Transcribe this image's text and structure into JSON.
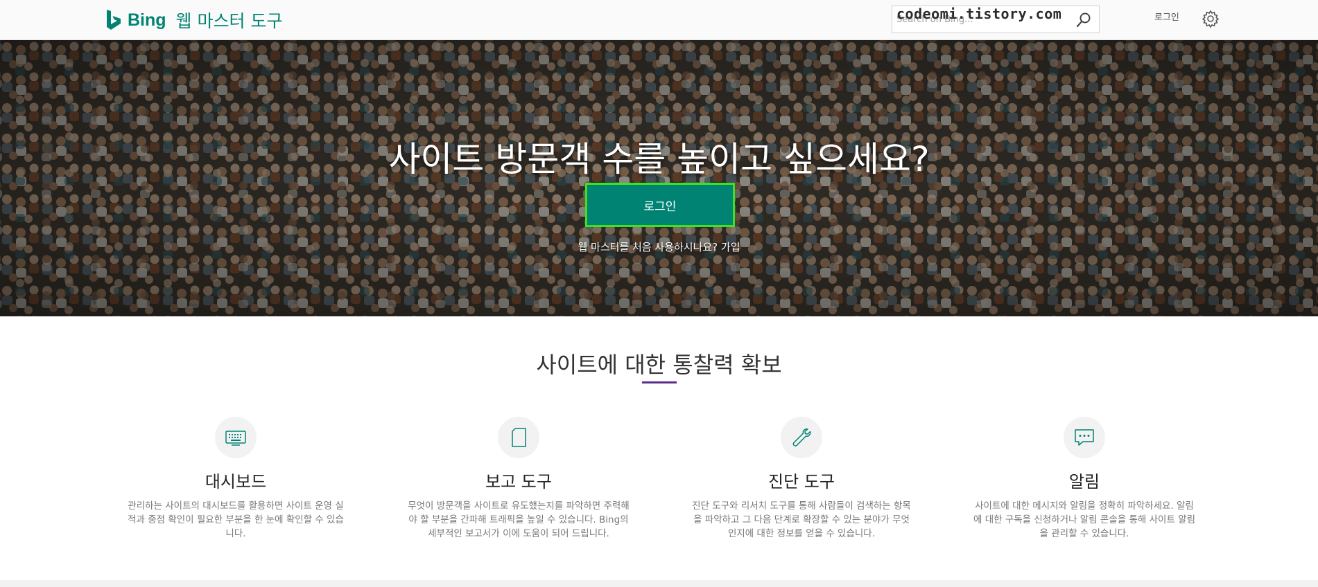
{
  "header": {
    "brand": "Bing",
    "product_title": "웹 마스터 도구",
    "search_placeholder": "Search on Bing...",
    "login_label": "로그인",
    "watermark": "codeomi.tistory.com"
  },
  "hero": {
    "headline": "사이트 방문객 수를 높이고 싶으세요?",
    "login_button": "로그인",
    "signup_prompt": "웹 마스터를 처음 사용하시나요?",
    "signup_link": "가입"
  },
  "insights": {
    "title": "사이트에 대한 통찰력 확보",
    "features": [
      {
        "icon": "keyboard-icon",
        "title": "대시보드",
        "description": "관리하는 사이트의 대시보드를 활용하면 사이트 운영 실적과 중점 확인이 필요한 부분을 한 눈에 확인할 수 있습니다."
      },
      {
        "icon": "report-icon",
        "title": "보고 도구",
        "description": "무엇이 방문객을 사이트로 유도했는지를 파악하면 주력해야 할 부분을 간파해 트래픽을 높일 수 있습니다. Bing의 세부적인 보고서가 이에 도움이 되어 드립니다."
      },
      {
        "icon": "wrench-icon",
        "title": "진단 도구",
        "description": "진단 도구와 리서치 도구를 통해 사람들이 검색하는 항목을 파악하고 그 다음 단계로 확장할 수 있는 분야가 무엇인지에 대한 정보를 얻을 수 있습니다."
      },
      {
        "icon": "chat-icon",
        "title": "알림",
        "description": "사이트에 대한 메시지와 알림을 정확히 파악하세요. 알림에 대한 구독을 신청하거나 알림 콘솔을 통해 사이트 알림을 관리할 수 있습니다."
      }
    ]
  },
  "colors": {
    "brand_teal": "#008373",
    "highlight_green": "#3de31c",
    "accent_purple": "#5c2d91"
  }
}
